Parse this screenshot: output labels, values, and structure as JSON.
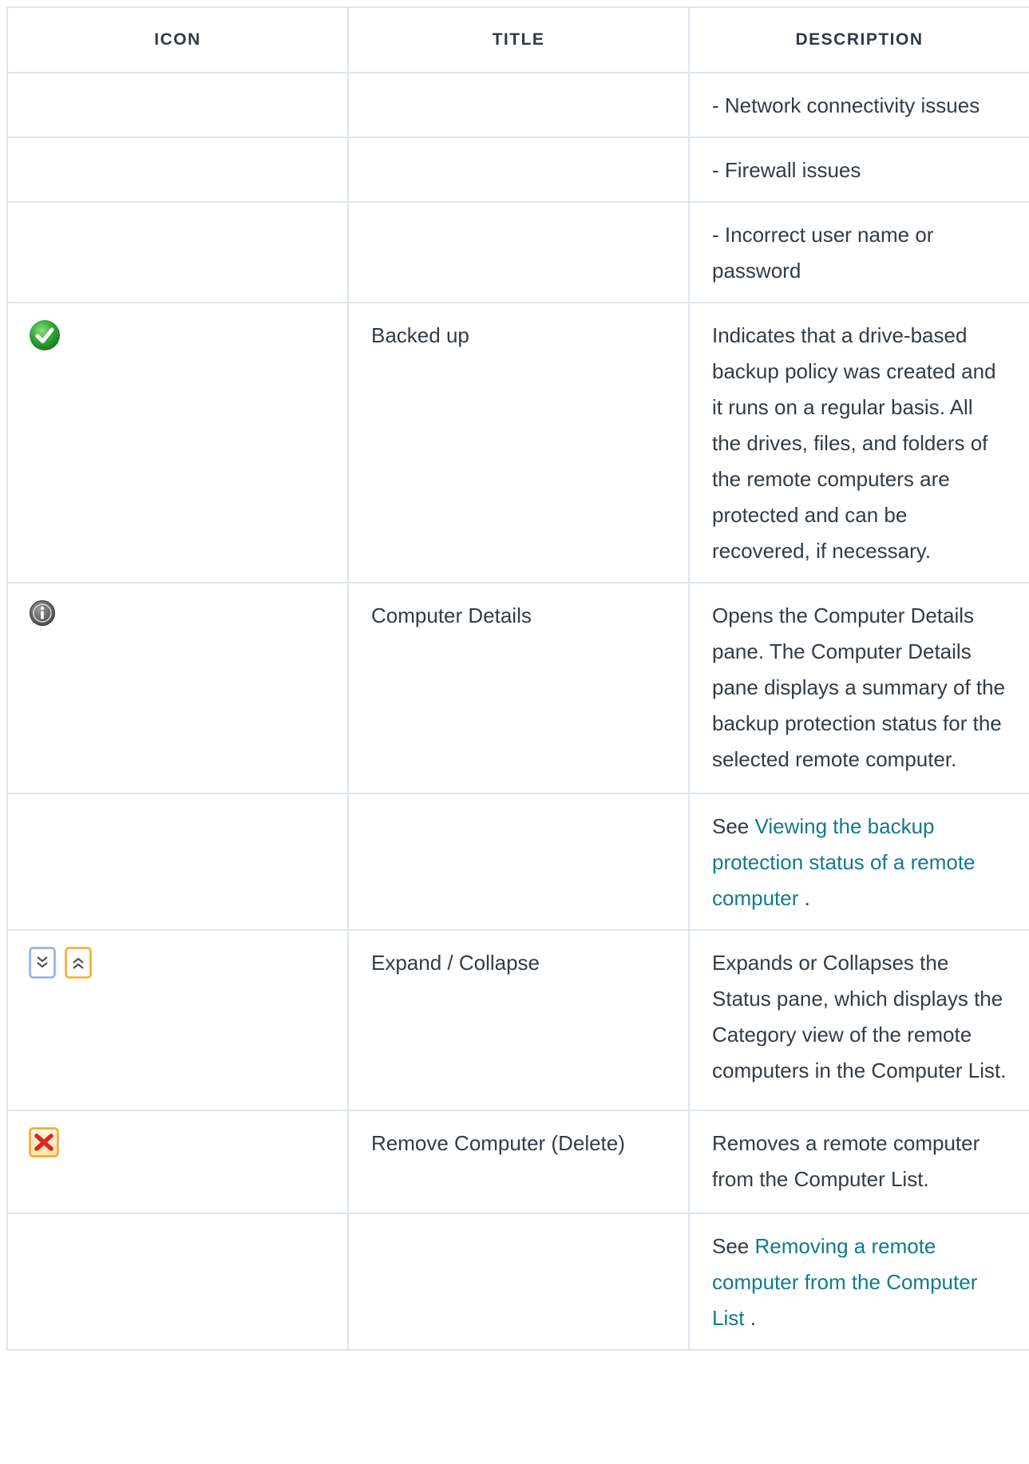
{
  "columns": {
    "icon": "ICON",
    "title": "TITLE",
    "description": "DESCRIPTION"
  },
  "rows": [
    {
      "icon": "",
      "title": "",
      "description": "- Network connectivity issues"
    },
    {
      "icon": "",
      "title": "",
      "description": "- Firewall issues"
    },
    {
      "icon": "",
      "title": "",
      "description": "- Incorrect user name or password"
    },
    {
      "icon": "green-checkmark-icon",
      "title": "Backed up",
      "description": "Indicates that a drive-based backup policy was created and it runs on a regular basis. All the drives, files, and folders of the remote computers are protected and can be recovered, if necessary."
    },
    {
      "icon": "info-icon",
      "title": "Computer Details",
      "description": "Opens the Computer Details pane. The Computer Details pane displays a summary of the backup protection status for the selected remote computer."
    },
    {
      "icon": "",
      "title": "",
      "see_prefix": "See ",
      "link_text": "Viewing the backup protection status of a remote computer",
      "see_suffix": " ."
    },
    {
      "icon": "expand-collapse-icons",
      "title": "Expand / Collapse",
      "description": "Expands or Collapses the Status pane, which displays the Category view of the remote computers in the Computer List."
    },
    {
      "icon": "remove-computer-icon",
      "title": "Remove Computer (Delete)",
      "description": "Removes a remote computer from the Computer List."
    },
    {
      "icon": "",
      "title": "",
      "see_prefix": "See ",
      "link_text": "Removing a remote computer from the Computer List",
      "see_suffix": " ."
    }
  ],
  "colors": {
    "link": "#117a8b",
    "border": "#dde5ee",
    "text": "#333c45"
  }
}
